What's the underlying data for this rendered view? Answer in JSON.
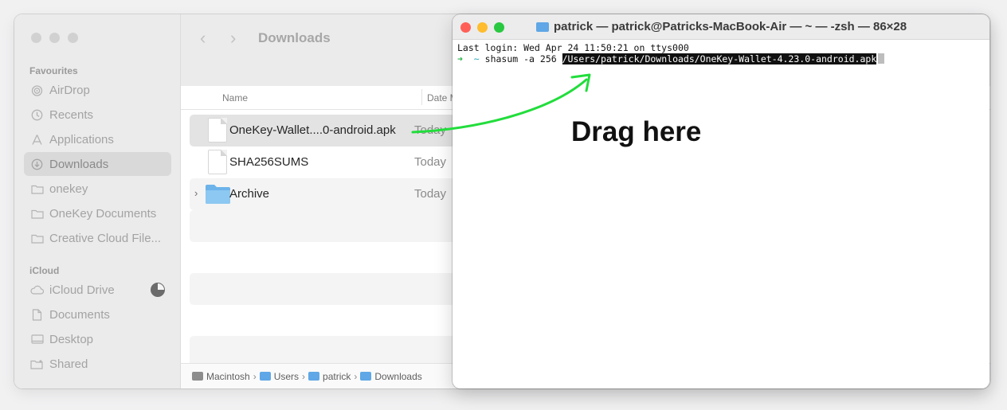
{
  "finder": {
    "sidebar": {
      "favourites_label": "Favourites",
      "favourites": [
        {
          "label": "AirDrop",
          "icon": "airdrop-icon"
        },
        {
          "label": "Recents",
          "icon": "clock-icon"
        },
        {
          "label": "Applications",
          "icon": "applications-icon"
        },
        {
          "label": "Downloads",
          "icon": "download-icon",
          "selected": true
        },
        {
          "label": "onekey",
          "icon": "folder-icon"
        },
        {
          "label": "OneKey Documents",
          "icon": "folder-icon"
        },
        {
          "label": "Creative Cloud File...",
          "icon": "folder-icon"
        }
      ],
      "icloud_label": "iCloud",
      "icloud": [
        {
          "label": "iCloud Drive",
          "icon": "cloud-icon"
        },
        {
          "label": "Documents",
          "icon": "document-icon"
        },
        {
          "label": "Desktop",
          "icon": "desktop-icon"
        },
        {
          "label": "Shared",
          "icon": "shared-folder-icon"
        }
      ]
    },
    "toolbar": {
      "back": "‹",
      "forward": "›",
      "title": "Downloads"
    },
    "columns": {
      "name": "Name",
      "date": "Date M"
    },
    "files": [
      {
        "name": "OneKey-Wallet....0-android.apk",
        "date": "Today",
        "kind": "document"
      },
      {
        "name": "SHA256SUMS",
        "date": "Today",
        "kind": "document"
      },
      {
        "name": "Archive",
        "date": "Today",
        "kind": "folder"
      }
    ],
    "pathbar": {
      "items": [
        "Macintosh",
        "Users",
        "patrick",
        "Downloads"
      ],
      "separator": "›"
    }
  },
  "terminal": {
    "title": "patrick — patrick@Patricks-MacBook-Air — ~ — -zsh — 86×28",
    "last_login": "Last login: Wed Apr 24 11:50:21 on ttys000",
    "prompt_arrow": "➜",
    "prompt_dir": "~",
    "command": " shasum -a 256 ",
    "path": "/Users/patrick/Downloads/OneKey-Wallet-4.23.0-android.apk"
  },
  "annotation": {
    "label": "Drag here",
    "arrow_color": "#22dd3c"
  },
  "colors": {
    "close": "#ff5f57",
    "minimize": "#febc2e",
    "zoom": "#28c840"
  }
}
